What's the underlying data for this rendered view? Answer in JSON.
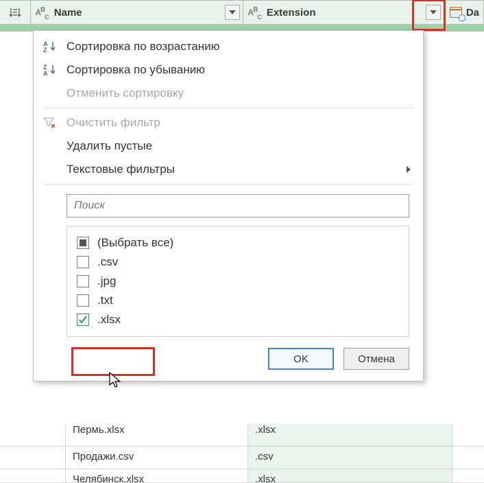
{
  "columns": {
    "name": "Name",
    "extension": "Extension",
    "date": "Da"
  },
  "menu": {
    "sort_asc": "Сортировка по возрастанию",
    "sort_desc": "Сортировка по убыванию",
    "clear_sort": "Отменить сортировку",
    "clear_filter": "Очистить фильтр",
    "remove_empty": "Удалить пустые",
    "text_filters": "Текстовые фильтры"
  },
  "search": {
    "placeholder": "Поиск"
  },
  "filter_values": {
    "select_all": "(Выбрать все)",
    "items": [
      {
        "label": ".csv",
        "checked": false
      },
      {
        "label": ".jpg",
        "checked": false
      },
      {
        "label": ".txt",
        "checked": false
      },
      {
        "label": ".xlsx",
        "checked": true
      }
    ]
  },
  "buttons": {
    "ok": "OK",
    "cancel": "Отмена"
  },
  "rows": [
    {
      "name": "Пермь.xlsx",
      "ext": ".xlsx"
    },
    {
      "name": "Продажи.csv",
      "ext": ".csv"
    },
    {
      "name": "Челябинск.xlsx",
      "ext": ".xlsx"
    }
  ]
}
